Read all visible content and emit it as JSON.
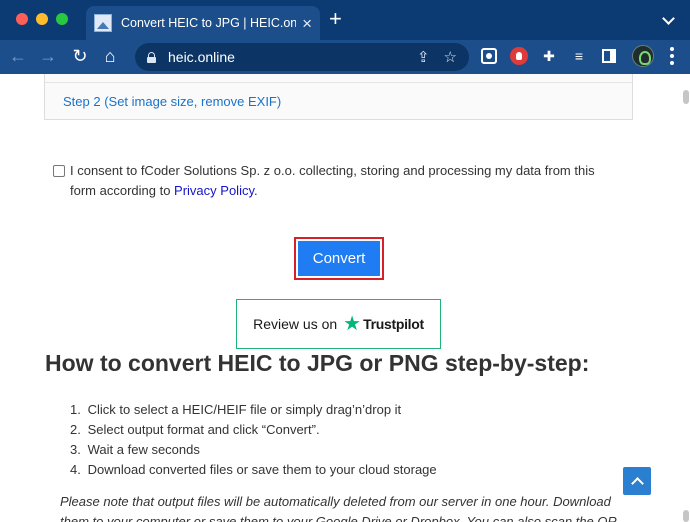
{
  "browser": {
    "tab": {
      "title": "Convert HEIC to JPG | HEIC.online",
      "close": "×"
    },
    "new_tab": "+",
    "nav": {
      "back": "←",
      "forward": "→",
      "reload": "↻",
      "home": "⌂"
    },
    "url": "heic.online",
    "icons": [
      "share-icon",
      "bookmark-star-icon",
      "screen-recorder-icon",
      "privacy-shield-icon",
      "extensions-puzzle-icon",
      "reading-list-icon",
      "sidebar-icon"
    ]
  },
  "page": {
    "step2_link": "Step 2 (Set image size, remove EXIF)",
    "consent": {
      "text": "I consent to fCoder Solutions Sp. z o.o. collecting, storing and processing my data from this form according to ",
      "link": "Privacy Policy",
      "suffix": "."
    },
    "convert_label": "Convert",
    "trustpilot": {
      "review": "Review us on",
      "brand": "Trustpilot"
    },
    "howto_title": "How to convert HEIC to JPG or PNG step-by-step:",
    "steps": [
      {
        "num": "1.",
        "text": "Click to select a HEIC/HEIF file or simply drag’n’drop it"
      },
      {
        "num": "2.",
        "text": "Select output format and click “Convert”."
      },
      {
        "num": "3.",
        "text": "Wait a few seconds"
      },
      {
        "num": "4.",
        "text": "Download converted files or save them to your cloud storage"
      }
    ],
    "note": "Please note that output files will be automatically deleted from our server in one hour. Download them to your computer or save them to your Google Drive or Dropbox. You can also scan the QR"
  },
  "colors": {
    "tabbar": "#0b3b72",
    "toolbar": "#1b4e8b",
    "convert_button": "#1f7cf2",
    "highlight_border": "#d6212b",
    "trustpilot_green": "#00b67a",
    "link": "#1a73c8"
  }
}
